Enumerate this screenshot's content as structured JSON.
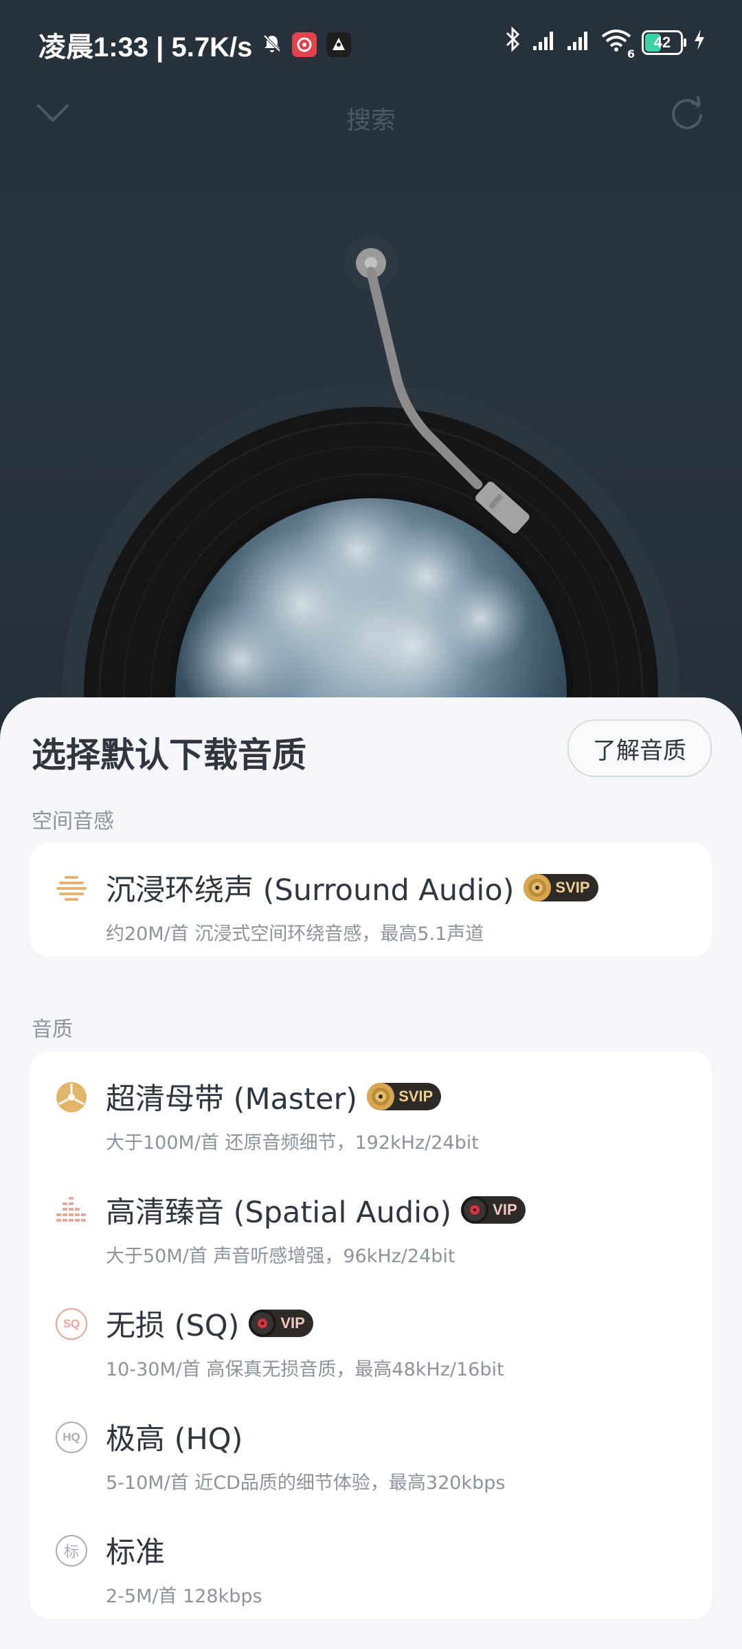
{
  "status_bar": {
    "left_text": "凌晨1:33 | 5.7K/s",
    "icons": [
      "mute-bell-icon",
      "netease-music-app-icon",
      "stream-app-icon"
    ],
    "right_icons": [
      "bluetooth-icon",
      "signal-icon",
      "signal-icon",
      "wifi-icon",
      "battery-icon",
      "charging-icon"
    ],
    "battery": "42",
    "wifi_label": "6"
  },
  "header": {
    "title": "搜索",
    "left_icon": "chevron-down-icon",
    "right_icon": "refresh-icon"
  },
  "sheet": {
    "title": "选择默认下载音质",
    "learn_button": "了解音质",
    "sections": [
      {
        "label": "空间音感",
        "items": [
          {
            "name": "沉浸环绕声 (Surround Audio)",
            "badge": "SVIP",
            "desc": "约20M/首 沉浸式空间环绕音感，最高5.1声道",
            "icon": "surround-audio-icon"
          }
        ]
      },
      {
        "label": "音质",
        "items": [
          {
            "name": "超清母带 (Master)",
            "badge": "SVIP",
            "desc": "大于100M/首 还原音频细节，192kHz/24bit",
            "icon": "master-disc-icon"
          },
          {
            "name": "高清臻音 (Spatial Audio)",
            "badge": "VIP",
            "desc": "大于50M/首 声音听感增强，96kHz/24bit",
            "icon": "equalizer-icon"
          },
          {
            "name": "无损 (SQ)",
            "badge": "VIP",
            "desc": "10-30M/首 高保真无损音质，最高48kHz/16bit",
            "icon": "sq-icon",
            "icon_text": "SQ"
          },
          {
            "name": "极高 (HQ)",
            "desc": "5-10M/首 近CD品质的细节体验，最高320kbps",
            "icon": "hq-icon",
            "icon_text": "HQ"
          },
          {
            "name": "标准",
            "desc": "2-5M/首 128kbps",
            "icon": "standard-icon",
            "icon_text": "标"
          }
        ]
      }
    ]
  },
  "colors": {
    "background_dark": "#27313b",
    "sheet_bg": "#f4f6fa",
    "card_bg": "#ffffff",
    "gold": "#e2b56b",
    "pink": "#e8a59c",
    "gray_icon": "#a8adb3"
  }
}
